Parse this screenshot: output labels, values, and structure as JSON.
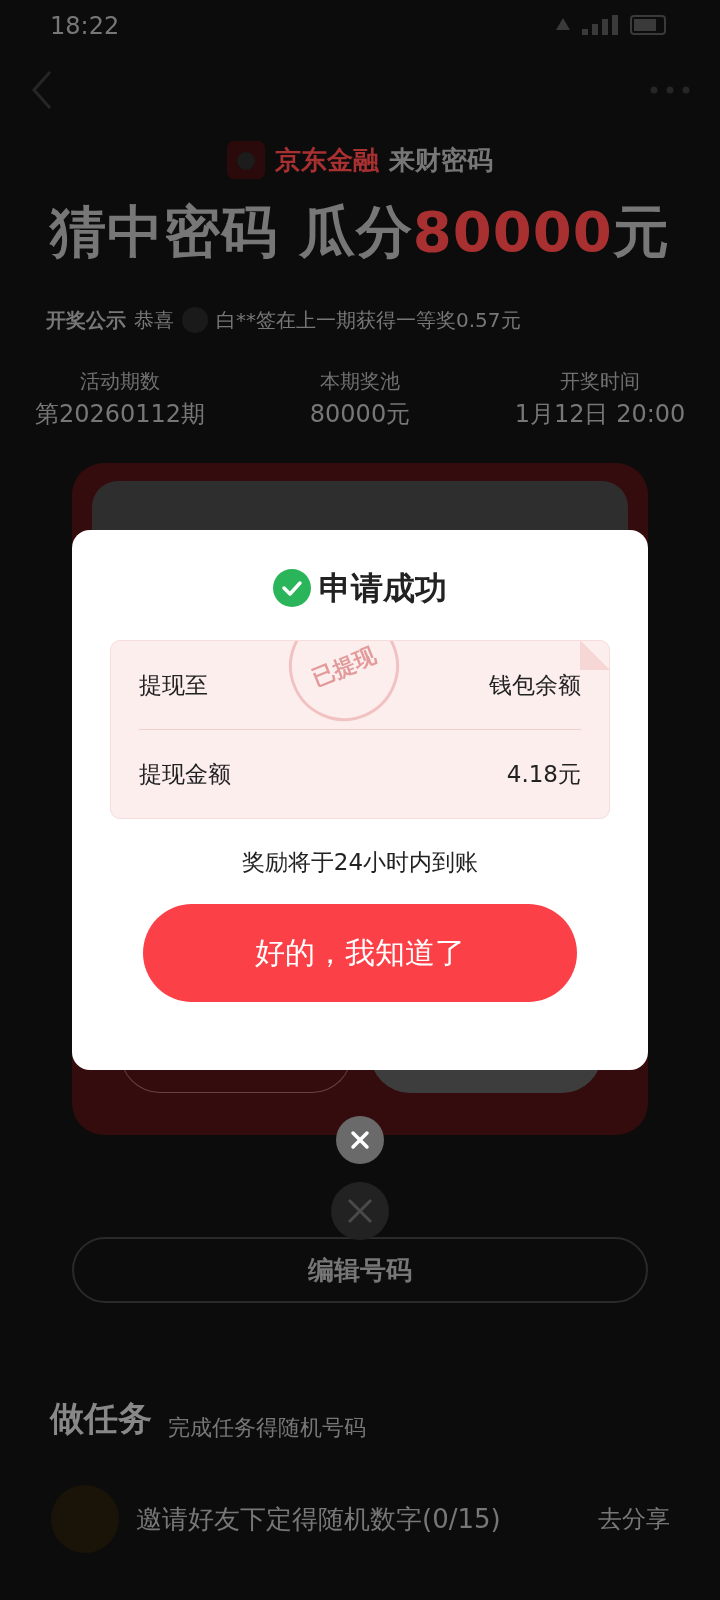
{
  "status_bar": {
    "time": "18:22"
  },
  "header": {
    "brand": "京东金融",
    "product": "来财密码",
    "headline_prefix": "猜中密码 瓜分",
    "headline_amount": "80000",
    "headline_suffix": "元"
  },
  "announcement": {
    "label": "开奖公示",
    "text": "恭喜",
    "winner_text": "白**签在上一期获得一等奖0.57元"
  },
  "stats": [
    {
      "label": "活动期数",
      "value": "第20260112期"
    },
    {
      "label": "本期奖池",
      "value": "80000元"
    },
    {
      "label": "开奖时间",
      "value": "1月12日 20:00"
    }
  ],
  "edit_button": "编辑号码",
  "tasks_section": {
    "title": "做任务",
    "subtitle": "完成任务得随机号码",
    "tasks": [
      {
        "title": "邀请好友下定得随机数字(0/15)",
        "action": "去分享"
      }
    ]
  },
  "dialog": {
    "title": "申请成功",
    "stamp": "已提现",
    "rows": [
      {
        "label": "提现至",
        "value": "钱包余额"
      },
      {
        "label": "提现金额",
        "value": "4.18元"
      }
    ],
    "note": "奖励将于24小时内到账",
    "button": "好的，我知道了"
  }
}
